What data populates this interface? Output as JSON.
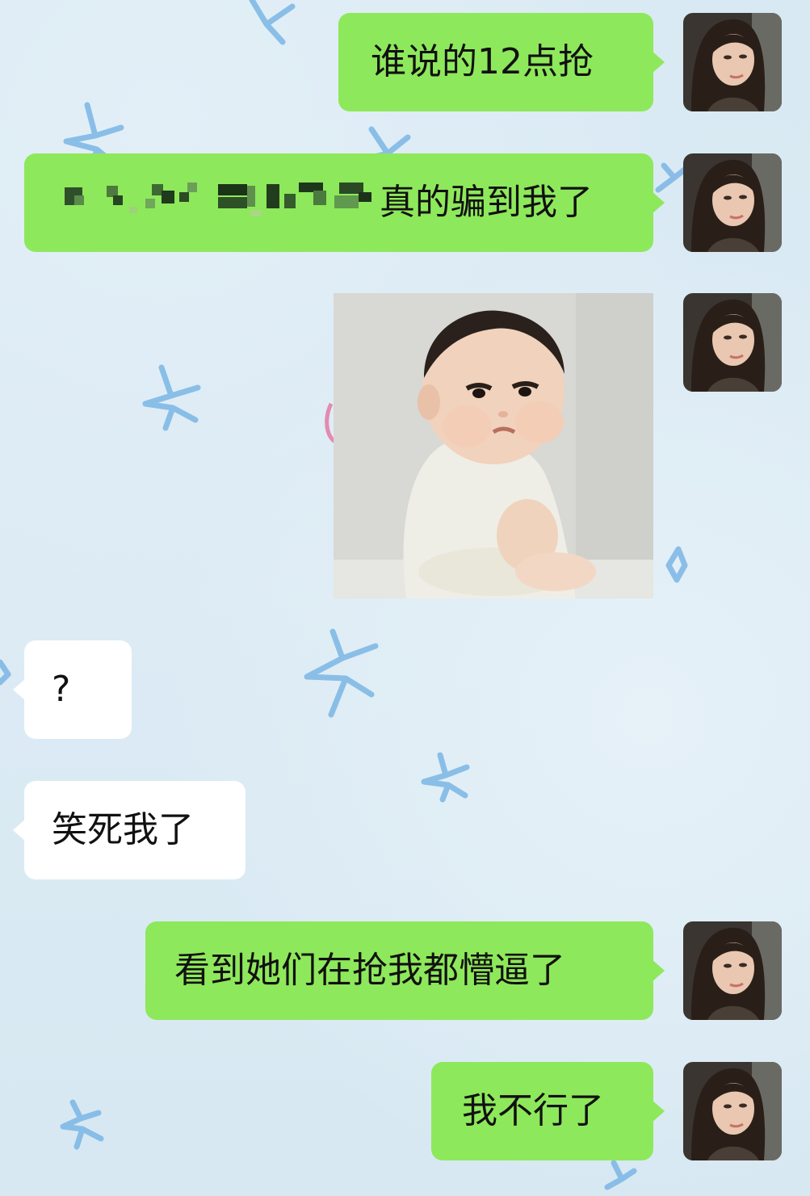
{
  "chat": {
    "messages": [
      {
        "id": "m1",
        "side": "right",
        "type": "text",
        "text": "谁说的12点抢"
      },
      {
        "id": "m2",
        "side": "right",
        "type": "text",
        "text": "真的骗到我了",
        "censored_prefix": true
      },
      {
        "id": "m3",
        "side": "right",
        "type": "image",
        "image_alt": "baby-pouting-sticker"
      },
      {
        "id": "m4",
        "side": "left",
        "type": "text",
        "text": "?"
      },
      {
        "id": "m5",
        "side": "left",
        "type": "text",
        "text": "笑死我了"
      },
      {
        "id": "m6",
        "side": "right",
        "type": "text",
        "text": "看到她们在抢我都懵逼了"
      },
      {
        "id": "m7",
        "side": "right",
        "type": "text",
        "text": "我不行了"
      }
    ]
  },
  "colors": {
    "sent_bubble": "#8ee85b",
    "received_bubble": "#ffffff",
    "background": "#d6e8f2",
    "doodle": "#7fb8e6"
  },
  "icons": {
    "avatar": "user-avatar-photo",
    "background_doodles": "star-doodle"
  }
}
